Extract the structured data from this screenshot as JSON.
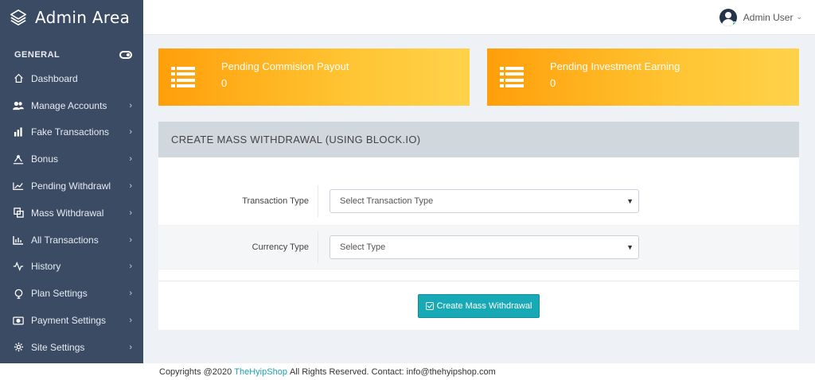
{
  "brand": {
    "title": "Admin Area"
  },
  "sidebar": {
    "section_title": "GENERAL",
    "items": [
      {
        "label": "Dashboard",
        "icon": "home-icon",
        "has_children": false
      },
      {
        "label": "Manage Accounts",
        "icon": "users-icon",
        "has_children": true
      },
      {
        "label": "Fake Transactions",
        "icon": "bar-chart-icon",
        "has_children": true
      },
      {
        "label": "Bonus",
        "icon": "bonus-icon",
        "has_children": true
      },
      {
        "label": "Pending Withdrawl",
        "icon": "line-chart-icon",
        "has_children": true
      },
      {
        "label": "Mass Withdrawal",
        "icon": "copy-icon",
        "has_children": true
      },
      {
        "label": "All Transactions",
        "icon": "column-chart-icon",
        "has_children": true
      },
      {
        "label": "History",
        "icon": "activity-icon",
        "has_children": true
      },
      {
        "label": "Plan Settings",
        "icon": "plan-icon",
        "has_children": true
      },
      {
        "label": "Payment Settings",
        "icon": "money-icon",
        "has_children": true
      },
      {
        "label": "Site Settings",
        "icon": "gear-icon",
        "has_children": true
      }
    ]
  },
  "topbar": {
    "user_name": "Admin User"
  },
  "stats": [
    {
      "title": "Pending Commision Payout",
      "value": "0",
      "icon": "list-icon"
    },
    {
      "title": "Pending Investment Earning",
      "value": "0",
      "icon": "list-icon"
    }
  ],
  "form": {
    "header": "CREATE MASS WITHDRAWAL (USING BLOCK.IO)",
    "fields": [
      {
        "label": "Transaction Type",
        "selected": "Select Transaction Type"
      },
      {
        "label": "Currency Type",
        "selected": "Select Type"
      }
    ],
    "submit_label": "Create Mass Withdrawal"
  },
  "footer": {
    "prefix": "Copyrights @2020",
    "link": "TheHyipShop",
    "suffix": "All Rights Reserved. Contact: info@thehyipshop.com"
  },
  "colors": {
    "sidebar_bg": "#3c4b64",
    "stat_gradient_start": "#ff9f0a",
    "stat_gradient_end": "#ffd24a",
    "panel_header_bg": "#d0d8de",
    "button_bg": "#17a9b5"
  }
}
